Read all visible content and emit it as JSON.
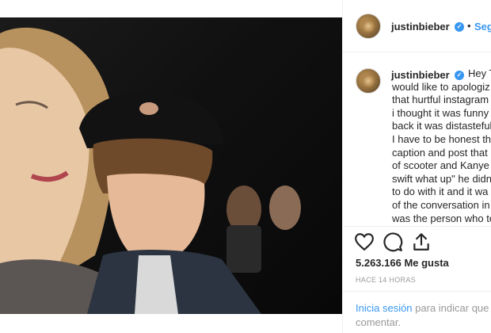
{
  "post": {
    "username": "justinbieber",
    "follow_label": "Segu",
    "separator": "•",
    "verified_glyph": "✓",
    "caption_lines": [
      "Hey Ta",
      "would like to apologiz",
      "that hurtful instagram",
      "i thought it was funny",
      "back it was distasteful",
      "I have to be honest th",
      "caption and post that",
      "of scooter and Kanye",
      "swift what up\" he didn",
      "to do with it and it wa",
      "of the conversation in",
      "was the person who to"
    ],
    "likes": "5.263.166 Me gusta",
    "time_ago": "HACE 14 HORAS",
    "login_link": "Inicia sesión",
    "login_rest_1": " para indicar que t",
    "login_rest_2": "comentar."
  },
  "colors": {
    "link_blue": "#3897f0",
    "verified_blue": "#3897f0",
    "border": "#efefef",
    "muted": "#999999"
  },
  "icons": {
    "like": "heart-icon",
    "comment": "comment-icon",
    "share": "share-icon",
    "verified": "verified-badge-icon"
  }
}
